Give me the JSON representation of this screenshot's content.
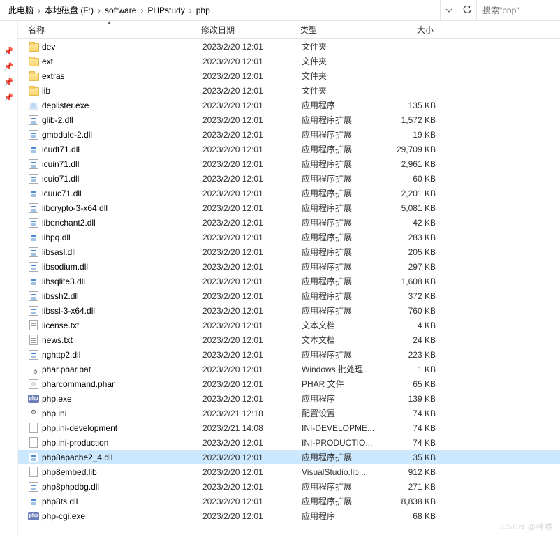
{
  "breadcrumb": [
    "此电脑",
    "本地磁盘 (F:)",
    "software",
    "PHPstudy",
    "php"
  ],
  "search": {
    "placeholder": "搜索\"php\""
  },
  "columns": {
    "name": "名称",
    "date": "修改日期",
    "type": "类型",
    "size": "大小"
  },
  "selected_name": "php8apache2_4.dll",
  "watermark": "CSDN @绮惑.",
  "icon_map": {
    "folder": "ico-folder",
    "exe": "ico-exe",
    "dll": "ico-dll",
    "gear": "ico-gear",
    "txt": "ico-txt",
    "bat": "ico-bat",
    "php": "ico-php",
    "phar": "ico-phar",
    "blank": "ico-blank"
  },
  "files": [
    {
      "name": "dev",
      "date": "2023/2/20 12:01",
      "type": "文件夹",
      "size": "",
      "icon": "folder"
    },
    {
      "name": "ext",
      "date": "2023/2/20 12:01",
      "type": "文件夹",
      "size": "",
      "icon": "folder"
    },
    {
      "name": "extras",
      "date": "2023/2/20 12:01",
      "type": "文件夹",
      "size": "",
      "icon": "folder"
    },
    {
      "name": "lib",
      "date": "2023/2/20 12:01",
      "type": "文件夹",
      "size": "",
      "icon": "folder"
    },
    {
      "name": "deplister.exe",
      "date": "2023/2/20 12:01",
      "type": "应用程序",
      "size": "135 KB",
      "icon": "exe"
    },
    {
      "name": "glib-2.dll",
      "date": "2023/2/20 12:01",
      "type": "应用程序扩展",
      "size": "1,572 KB",
      "icon": "dll"
    },
    {
      "name": "gmodule-2.dll",
      "date": "2023/2/20 12:01",
      "type": "应用程序扩展",
      "size": "19 KB",
      "icon": "dll"
    },
    {
      "name": "icudt71.dll",
      "date": "2023/2/20 12:01",
      "type": "应用程序扩展",
      "size": "29,709 KB",
      "icon": "dll"
    },
    {
      "name": "icuin71.dll",
      "date": "2023/2/20 12:01",
      "type": "应用程序扩展",
      "size": "2,961 KB",
      "icon": "dll"
    },
    {
      "name": "icuio71.dll",
      "date": "2023/2/20 12:01",
      "type": "应用程序扩展",
      "size": "60 KB",
      "icon": "dll"
    },
    {
      "name": "icuuc71.dll",
      "date": "2023/2/20 12:01",
      "type": "应用程序扩展",
      "size": "2,201 KB",
      "icon": "dll"
    },
    {
      "name": "libcrypto-3-x64.dll",
      "date": "2023/2/20 12:01",
      "type": "应用程序扩展",
      "size": "5,081 KB",
      "icon": "dll"
    },
    {
      "name": "libenchant2.dll",
      "date": "2023/2/20 12:01",
      "type": "应用程序扩展",
      "size": "42 KB",
      "icon": "dll"
    },
    {
      "name": "libpq.dll",
      "date": "2023/2/20 12:01",
      "type": "应用程序扩展",
      "size": "283 KB",
      "icon": "dll"
    },
    {
      "name": "libsasl.dll",
      "date": "2023/2/20 12:01",
      "type": "应用程序扩展",
      "size": "205 KB",
      "icon": "dll"
    },
    {
      "name": "libsodium.dll",
      "date": "2023/2/20 12:01",
      "type": "应用程序扩展",
      "size": "297 KB",
      "icon": "dll"
    },
    {
      "name": "libsqlite3.dll",
      "date": "2023/2/20 12:01",
      "type": "应用程序扩展",
      "size": "1,608 KB",
      "icon": "dll"
    },
    {
      "name": "libssh2.dll",
      "date": "2023/2/20 12:01",
      "type": "应用程序扩展",
      "size": "372 KB",
      "icon": "dll"
    },
    {
      "name": "libssl-3-x64.dll",
      "date": "2023/2/20 12:01",
      "type": "应用程序扩展",
      "size": "760 KB",
      "icon": "dll"
    },
    {
      "name": "license.txt",
      "date": "2023/2/20 12:01",
      "type": "文本文档",
      "size": "4 KB",
      "icon": "txt"
    },
    {
      "name": "news.txt",
      "date": "2023/2/20 12:01",
      "type": "文本文档",
      "size": "24 KB",
      "icon": "txt"
    },
    {
      "name": "nghttp2.dll",
      "date": "2023/2/20 12:01",
      "type": "应用程序扩展",
      "size": "223 KB",
      "icon": "dll"
    },
    {
      "name": "phar.phar.bat",
      "date": "2023/2/20 12:01",
      "type": "Windows 批处理...",
      "size": "1 KB",
      "icon": "bat"
    },
    {
      "name": "pharcommand.phar",
      "date": "2023/2/20 12:01",
      "type": "PHAR 文件",
      "size": "65 KB",
      "icon": "phar"
    },
    {
      "name": "php.exe",
      "date": "2023/2/20 12:01",
      "type": "应用程序",
      "size": "139 KB",
      "icon": "php"
    },
    {
      "name": "php.ini",
      "date": "2023/2/21 12:18",
      "type": "配置设置",
      "size": "74 KB",
      "icon": "gear"
    },
    {
      "name": "php.ini-development",
      "date": "2023/2/21 14:08",
      "type": "INI-DEVELOPME...",
      "size": "74 KB",
      "icon": "blank"
    },
    {
      "name": "php.ini-production",
      "date": "2023/2/20 12:01",
      "type": "INI-PRODUCTIO...",
      "size": "74 KB",
      "icon": "blank"
    },
    {
      "name": "php8apache2_4.dll",
      "date": "2023/2/20 12:01",
      "type": "应用程序扩展",
      "size": "35 KB",
      "icon": "dll"
    },
    {
      "name": "php8embed.lib",
      "date": "2023/2/20 12:01",
      "type": "VisualStudio.lib....",
      "size": "912 KB",
      "icon": "blank"
    },
    {
      "name": "php8phpdbg.dll",
      "date": "2023/2/20 12:01",
      "type": "应用程序扩展",
      "size": "271 KB",
      "icon": "dll"
    },
    {
      "name": "php8ts.dll",
      "date": "2023/2/20 12:01",
      "type": "应用程序扩展",
      "size": "8,838 KB",
      "icon": "dll"
    },
    {
      "name": "php-cgi.exe",
      "date": "2023/2/20 12:01",
      "type": "应用程序",
      "size": "68 KB",
      "icon": "php"
    }
  ]
}
